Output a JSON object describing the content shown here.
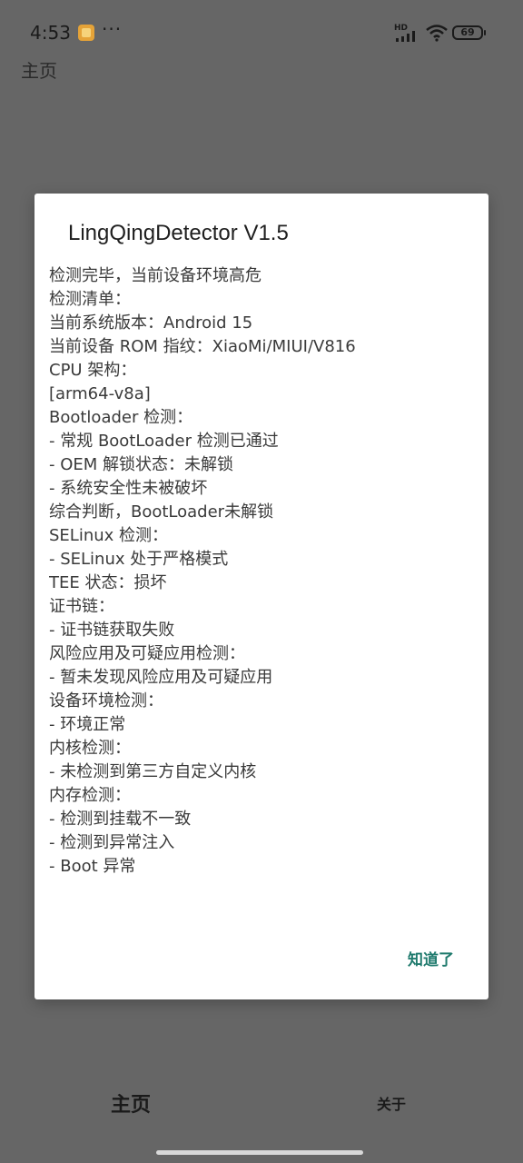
{
  "status_bar": {
    "time": "4:53",
    "more": "···",
    "network_label": "HD",
    "battery": "69"
  },
  "app_bar": {
    "title": "主页"
  },
  "dialog": {
    "title": "LingQingDetector V1.5",
    "lines": [
      "检测完毕，当前设备环境高危",
      "检测清单：",
      "当前系统版本：Android 15",
      "当前设备 ROM 指纹：XiaoMi/MIUI/V816",
      "CPU 架构：",
      "[arm64-v8a]",
      "Bootloader 检测：",
      " - 常规 BootLoader 检测已通过",
      " - OEM 解锁状态：未解锁",
      " - 系统安全性未被破坏",
      "综合判断，BootLoader未解锁",
      "SELinux 检测：",
      " - SELinux 处于严格模式",
      "TEE 状态：损坏",
      "证书链：",
      " - 证书链获取失败",
      "风险应用及可疑应用检测：",
      " - 暂未发现风险应用及可疑应用",
      "设备环境检测：",
      " - 环境正常",
      "内核检测：",
      " - 未检测到第三方自定义内核",
      "内存检测：",
      " - 检测到挂载不一致",
      " - 检测到异常注入",
      " - Boot 异常"
    ],
    "ok_label": "知道了"
  },
  "bottom_nav": {
    "home_label": "主页",
    "about_label": "关于"
  },
  "colors": {
    "scrim": "#666666",
    "dialog_bg": "#ffffff",
    "accent": "#1f7a6d"
  }
}
